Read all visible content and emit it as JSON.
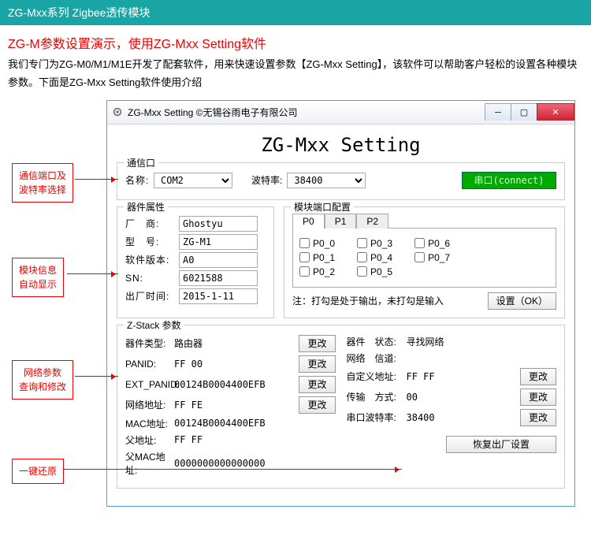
{
  "header": "ZG-Mxx系列 Zigbee透传模块",
  "redTitle": "ZG-M参数设置演示，使用ZG-Mxx Setting软件",
  "desc": "我们专门为ZG-M0/M1/M1E开发了配套软件，用来快速设置参数【ZG-Mxx Setting】，该软件可以帮助客户轻松的设置各种模块参数。下面是ZG-Mxx Setting软件使用介绍",
  "ann": {
    "a1l1": "通信端口及",
    "a1l2": "波特率选择",
    "a2l1": "模块信息",
    "a2l2": "自动显示",
    "a3l1": "网络参数",
    "a3l2": "查询和修改",
    "a4": "一键还原"
  },
  "win": {
    "title": "ZG-Mxx Setting ©无锡谷雨电子有限公司",
    "appTitle": "ZG-Mxx Setting"
  },
  "comm": {
    "legend": "通信口",
    "nameLbl": "名称:",
    "nameVal": "COM2",
    "baudLbl": "波特率:",
    "baudVal": "38400",
    "connBtn": "串口(connect)"
  },
  "attr": {
    "legend": "器件属性",
    "vendorLbl": "厂　商:",
    "vendor": "Ghostyu",
    "modelLbl": "型　号:",
    "model": "ZG-M1",
    "verLbl": "软件版本:",
    "ver": "A0",
    "snLbl": "SN:",
    "sn": "6021588",
    "dateLbl": "出厂时间:",
    "date": "2015-1-11"
  },
  "port": {
    "legend": "模块端口配置",
    "tabs": [
      "P0",
      "P1",
      "P2"
    ],
    "p00": "P0_0",
    "p01": "P0_1",
    "p02": "P0_2",
    "p03": "P0_3",
    "p04": "P0_4",
    "p05": "P0_5",
    "p06": "P0_6",
    "p07": "P0_7",
    "note": "注：打勾是处于输出，未打勾是输入",
    "okBtn": "设置（OK）"
  },
  "zs": {
    "legend": "Z-Stack 参数",
    "typeLbl": "器件类型:",
    "type": "路由器",
    "panidLbl": "PANID:",
    "panid": "FF 00",
    "extLbl": "EXT_PANID:",
    "ext": "00124B0004400EFB",
    "netLbl": "网络地址:",
    "net": "FF FE",
    "macLbl": "MAC地址:",
    "mac": "00124B0004400EFB",
    "paddrLbl": "父地址:",
    "paddr": "FF FF",
    "pmacLbl": "父MAC地址:",
    "pmac": "0000000000000000",
    "statLbl": "器件　状态:",
    "stat": "寻找网络",
    "chLbl": "网络　信道:",
    "ch": "",
    "custLbl": "自定义地址:",
    "cust": "FF FF",
    "txLbl": "传输　方式:",
    "tx": "00",
    "sbLbl": "串口波特率:",
    "sb": "38400",
    "chgBtn": "更改",
    "resetBtn": "恢复出厂设置"
  }
}
